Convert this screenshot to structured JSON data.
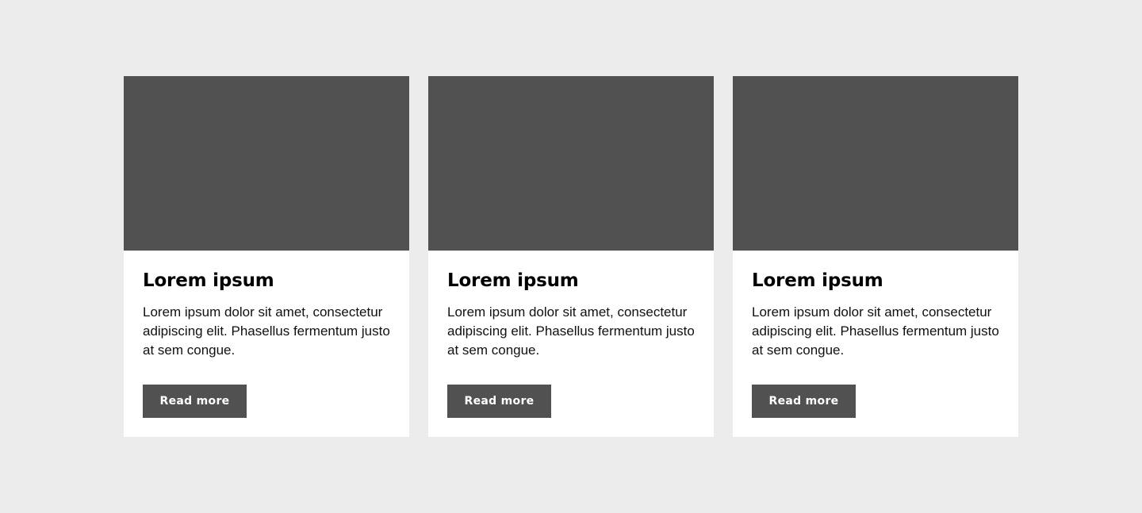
{
  "colors": {
    "background": "#ececec",
    "card": "#ffffff",
    "image_placeholder": "#515151",
    "button": "#515151",
    "button_text": "#ffffff",
    "text": "#000000"
  },
  "cards": [
    {
      "title": "Lorem ipsum",
      "text": "Lorem ipsum dolor sit amet, consectetur adipiscing elit. Phasellus fermentum justo at sem congue.",
      "button_label": "Read more"
    },
    {
      "title": "Lorem ipsum",
      "text": "Lorem ipsum dolor sit amet, consectetur adipiscing elit. Phasellus fermentum justo at sem congue.",
      "button_label": "Read more"
    },
    {
      "title": "Lorem ipsum",
      "text": "Lorem ipsum dolor sit amet, consectetur adipiscing elit. Phasellus fermentum justo at sem congue.",
      "button_label": "Read more"
    }
  ]
}
